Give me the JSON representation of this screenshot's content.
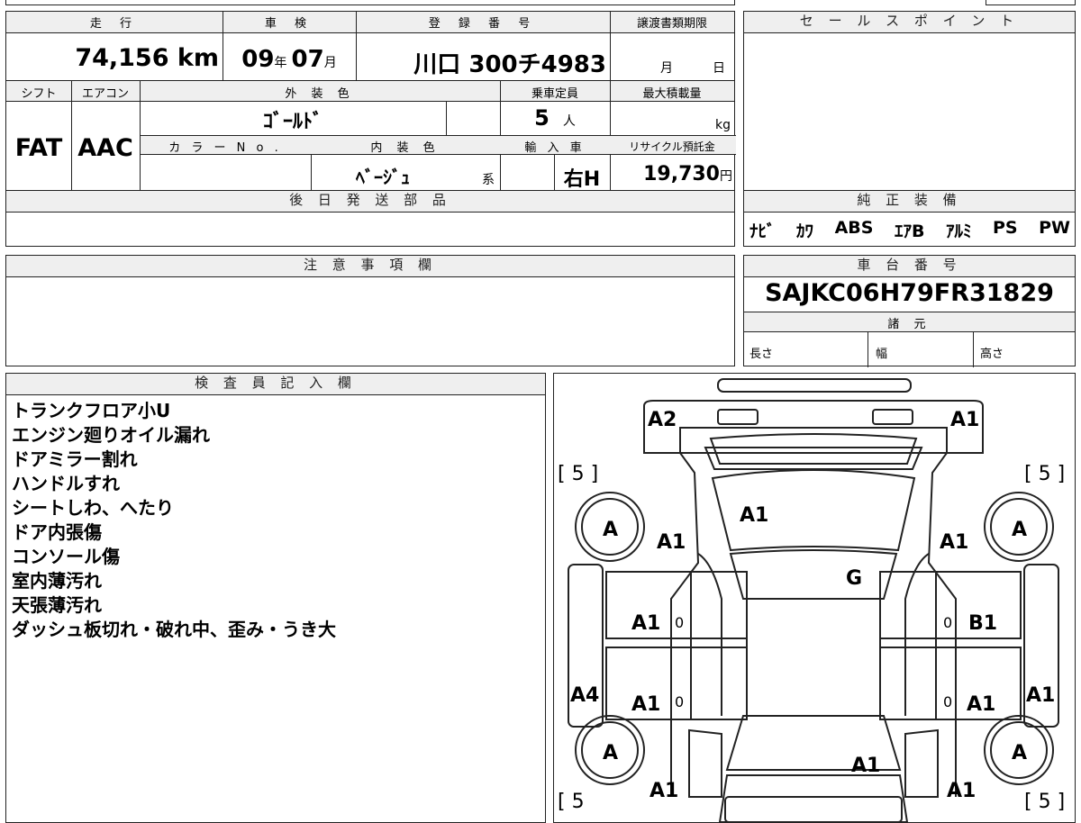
{
  "header": {
    "mileage_label": "走 行",
    "shaken_label": "車 検",
    "reg_label": "登 録 番 号",
    "transfer_label": "譲渡書類期限",
    "sales_label": "セ ー ル ス ポ イ ン ト"
  },
  "values": {
    "mileage": "74,156 km",
    "shaken_year": "09",
    "shaken_year_unit": "年",
    "shaken_month": "07",
    "shaken_month_unit": "月",
    "reg_number": "川口 300チ4983",
    "transfer_month": "月",
    "transfer_day": "日"
  },
  "specs": {
    "shift_label": "シフト",
    "ac_label": "エアコン",
    "ext_color_label": "外 装 色",
    "capacity_label": "乗車定員",
    "max_load_label": "最大積載量",
    "shift": "FAT",
    "ac": "AAC",
    "ext_color": "ｺﾞｰﾙﾄﾞ",
    "capacity": "5",
    "capacity_unit": "人",
    "max_load_unit": "kg",
    "color_no_label": "カ ラ ー N o .",
    "int_color_label": "内 装 色",
    "import_label": "輸 入 車",
    "recycle_label": "リサイクル預託金",
    "int_color": "ﾍﾞｰｼﾞｭ",
    "int_color_suffix": "系",
    "import_value": "右H",
    "recycle_value": "19,730",
    "recycle_unit": "円"
  },
  "later_parts_label": "後 日 発 送 部 品",
  "factory_equipment": {
    "label": "純 正 装 備",
    "items": [
      "ﾅﾋﾞ",
      "ｶﾜ",
      "ABS",
      "ｴｱB",
      "ｱﾙﾐ",
      "PS",
      "PW"
    ]
  },
  "notes_label": "注 意 事 項 欄",
  "chassis": {
    "label": "車 台 番 号",
    "number": "SAJKC06H79FR31829",
    "specs_label": "諸 元",
    "length_label": "長さ",
    "width_label": "幅",
    "height_label": "高さ"
  },
  "inspector": {
    "label": "検 査 員 記 入 欄",
    "lines": [
      "トランクフロア小U",
      "エンジン廻りオイル漏れ",
      "ドアミラー割れ",
      "ハンドルすれ",
      "シートしわ、へたり",
      "ドア内張傷",
      "コンソール傷",
      "室内薄汚れ",
      "天張薄汚れ",
      "ダッシュ板切れ・破れ中、歪み・うき大"
    ]
  },
  "diagram": {
    "front_left": "A2",
    "front_right": "A1",
    "tread_fl": "[ 5 ]",
    "tread_fr": "[ 5 ]",
    "tread_rl": "[ 5",
    "tread_rr": "[ 5 ]",
    "wheel_fl": "A",
    "wheel_fr": "A",
    "wheel_rl": "A",
    "wheel_rr": "A",
    "hood": "A1",
    "fender_left": "A1",
    "fender_right": "A1",
    "windshield": "G",
    "door_fl": "A1",
    "door_fr": "B1",
    "door_rl": "A1",
    "door_rr": "A1",
    "handle_fl": "0",
    "handle_fr": "0",
    "handle_rl": "0",
    "handle_rr": "0",
    "side_left": "A4",
    "side_right": "A1",
    "roof_rear": "A1",
    "quarter_left": "A1",
    "quarter_right": "A1"
  }
}
